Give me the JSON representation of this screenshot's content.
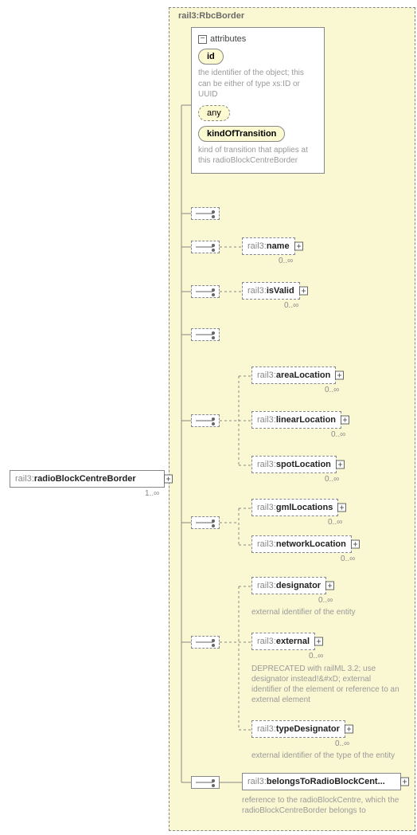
{
  "container": {
    "title": "rail3:RbcBorder"
  },
  "root": {
    "prefix": "rail3:",
    "local": "radioBlockCentreBorder",
    "card": "1..∞"
  },
  "attributes": {
    "header": "attributes",
    "id_label": "id",
    "id_desc": "the identifier of the object; this can be either of type xs:ID or UUID",
    "any_label": "any",
    "kind_label": "kindOfTransition",
    "kind_desc": "kind of transition that applies at this radioBlockCentreBorder"
  },
  "nodes": {
    "name": {
      "prefix": "rail3:",
      "local": "name",
      "card": "0..∞"
    },
    "isValid": {
      "prefix": "rail3:",
      "local": "isValid",
      "card": "0..∞"
    },
    "areaLocation": {
      "prefix": "rail3:",
      "local": "areaLocation",
      "card": "0..∞"
    },
    "linearLocation": {
      "prefix": "rail3:",
      "local": "linearLocation",
      "card": "0..∞"
    },
    "spotLocation": {
      "prefix": "rail3:",
      "local": "spotLocation",
      "card": "0..∞"
    },
    "gmlLocations": {
      "prefix": "rail3:",
      "local": "gmlLocations",
      "card": "0..∞"
    },
    "networkLocation": {
      "prefix": "rail3:",
      "local": "networkLocation",
      "card": "0..∞"
    },
    "designator": {
      "prefix": "rail3:",
      "local": "designator",
      "card": "0..∞",
      "desc": "external identifier of the entity"
    },
    "external": {
      "prefix": "rail3:",
      "local": "external",
      "card": "0..∞",
      "desc": "DEPRECATED with railML 3.2; use designator instead!&#xD; external identifier of the element or reference to an external element"
    },
    "typeDesignator": {
      "prefix": "rail3:",
      "local": "typeDesignator",
      "card": "0..∞",
      "desc": "external identifier of the type of the entity"
    },
    "belongs": {
      "prefix": "rail3:",
      "local": "belongsToRadioBlockCent...",
      "desc": "reference to the radioBlockCentre, which the radioBlockCentreBorder belongs to"
    }
  }
}
